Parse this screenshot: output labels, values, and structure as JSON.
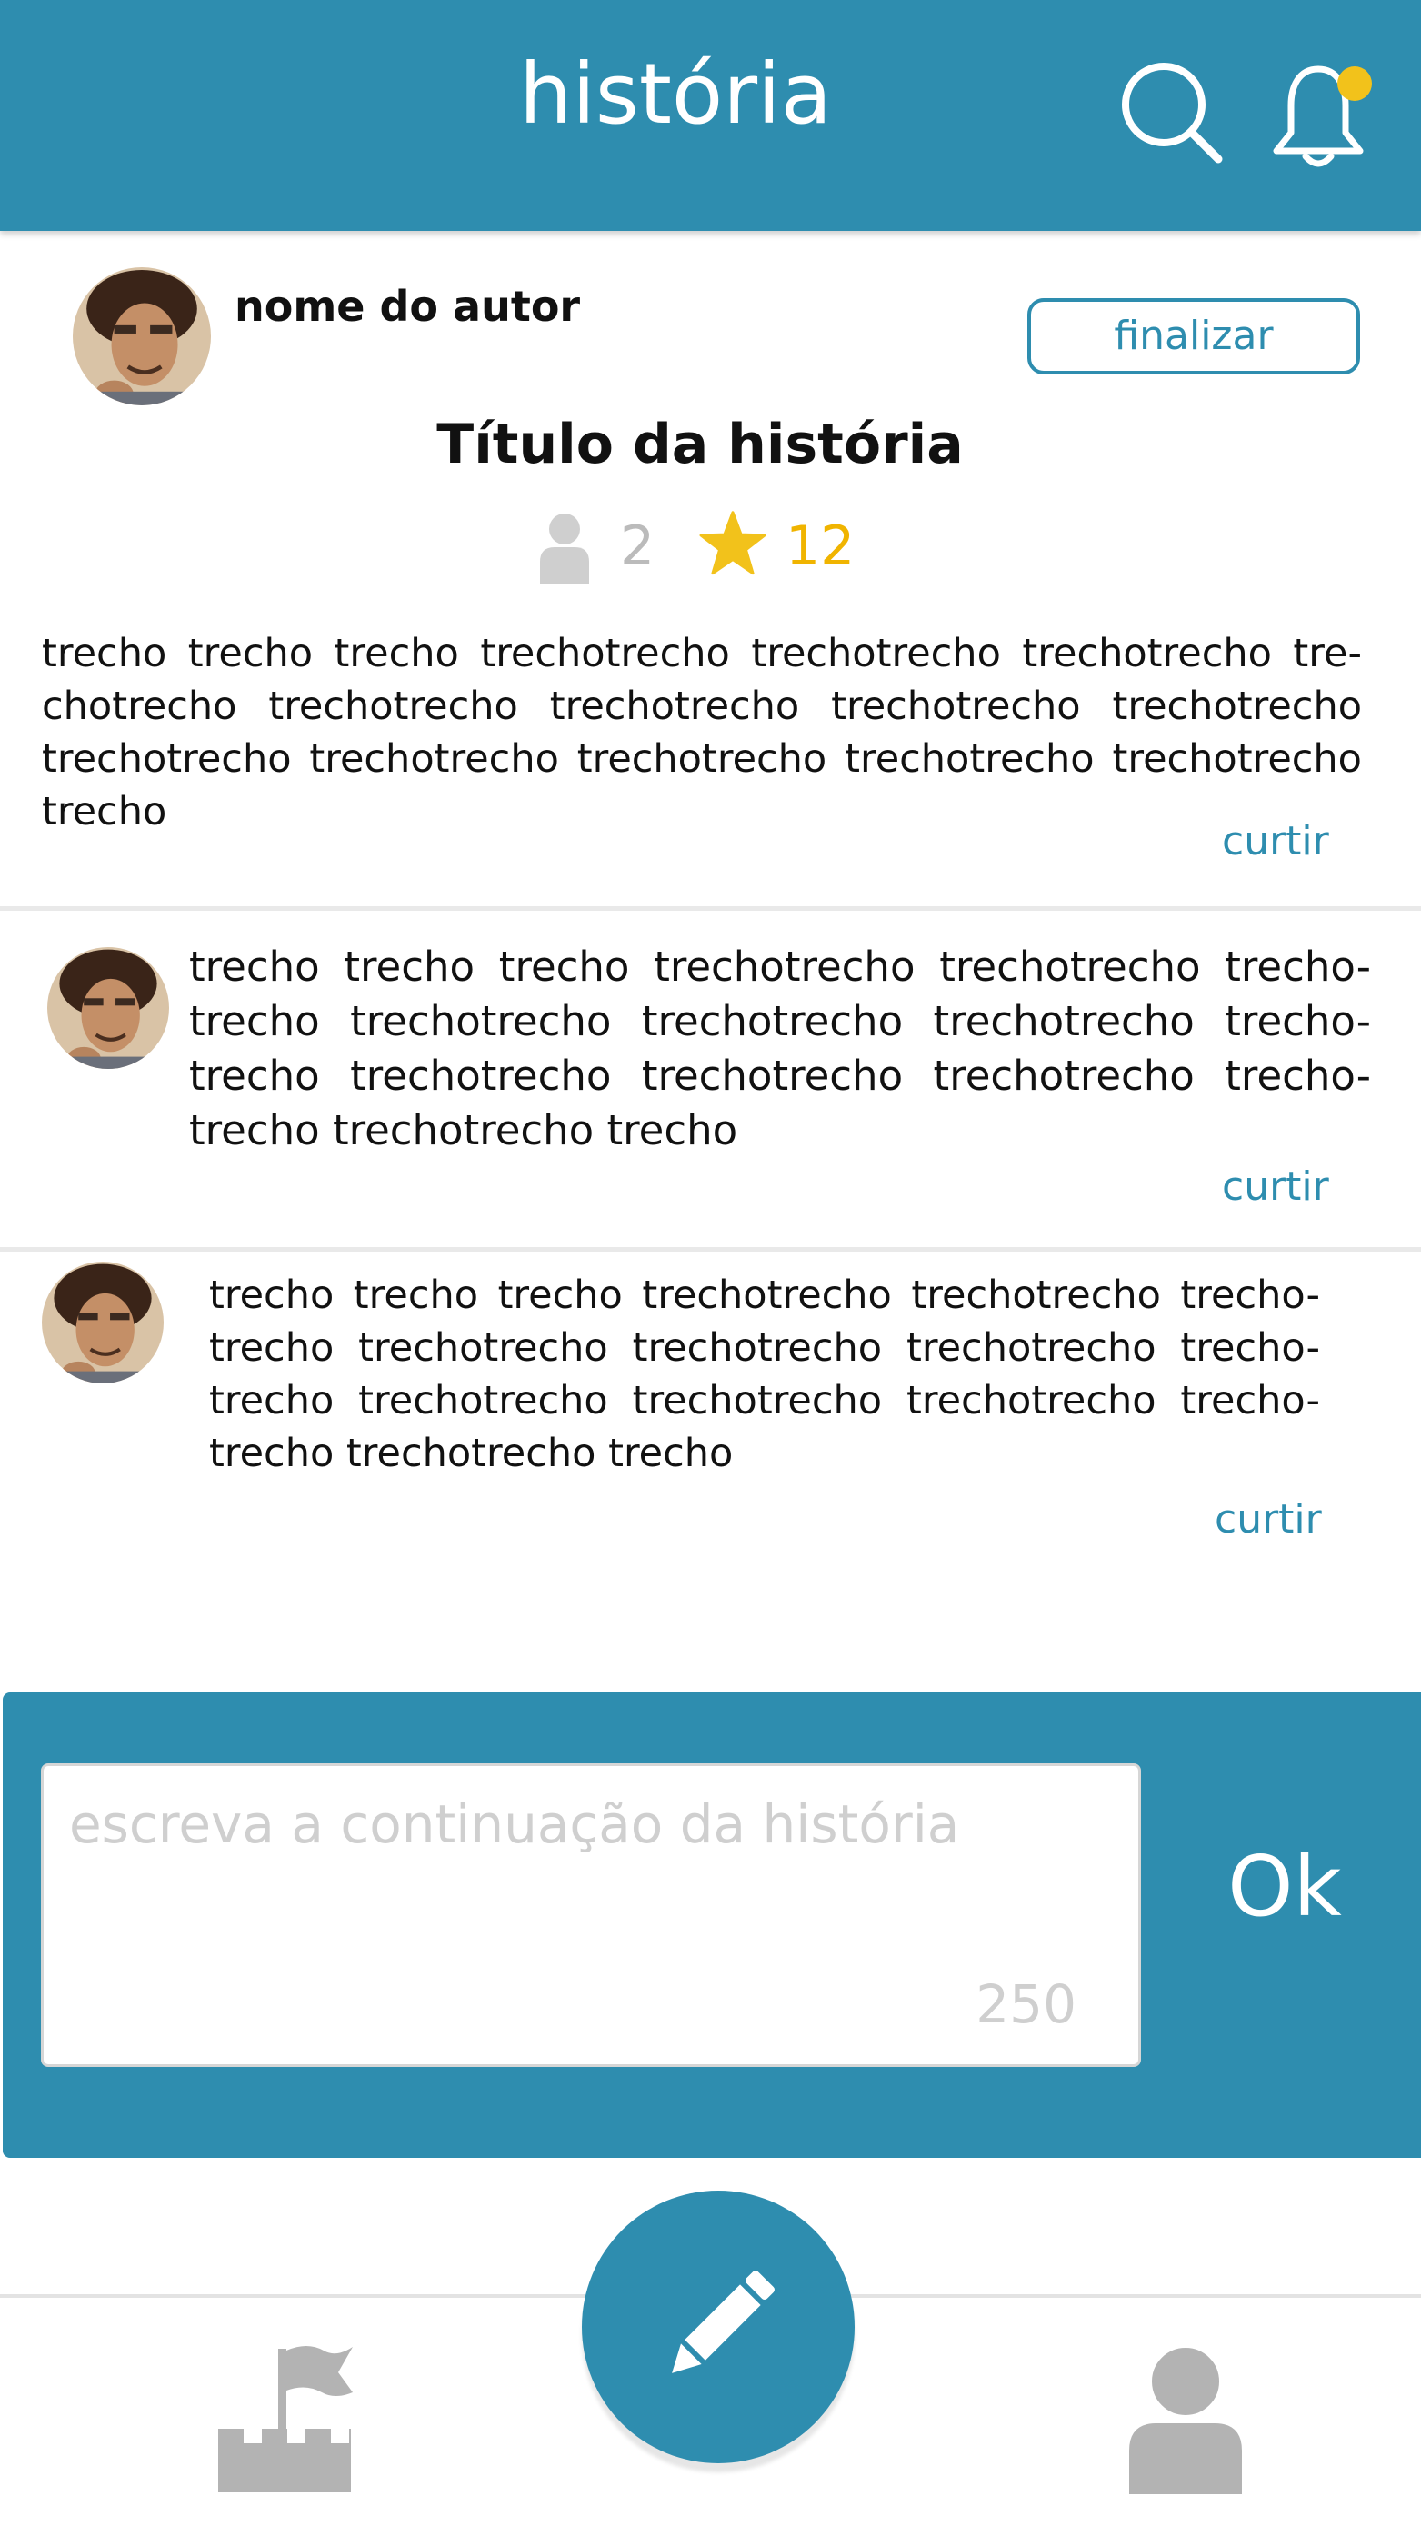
{
  "header": {
    "title": "história",
    "accent_color": "#2e8daf",
    "notification_dot_color": "#f2c21b",
    "icons": [
      "search-icon",
      "bell-icon"
    ]
  },
  "story": {
    "author_name": "nome do autor",
    "finish_label": "finalizar",
    "title": "Título da história",
    "followers": "2",
    "stars": "12",
    "excerpt": "trecho trecho trecho trechotrecho trechotrecho trechotrecho tre-chotrecho trechotrecho trechotrecho trechotrecho trechotrecho trechotrecho trechotrecho trechotrecho trechotrecho trechotrecho trecho",
    "like_label": "curtir"
  },
  "continuations": [
    {
      "text": "trecho trecho trecho trechotrecho trechotrecho trecho-trecho trechotrecho trechotrecho trechotrecho trecho-trecho trechotrecho trechotrecho trechotrecho trecho-trecho trechotrecho trecho",
      "like_label": "curtir"
    },
    {
      "text": "trecho trecho trecho trechotrecho trechotrecho trecho-trecho trechotrecho trechotrecho trechotrecho trecho-trecho trechotrecho trechotrecho trechotrecho trecho-trecho trechotrecho trecho",
      "like_label": "curtir"
    }
  ],
  "composer": {
    "placeholder": "escreva a continuação da história",
    "counter": "250",
    "ok_label": "Ok"
  },
  "bottom_nav": {
    "items": [
      "castle-flag-icon",
      "pencil-icon",
      "profile-icon"
    ],
    "active": "pencil-icon"
  }
}
